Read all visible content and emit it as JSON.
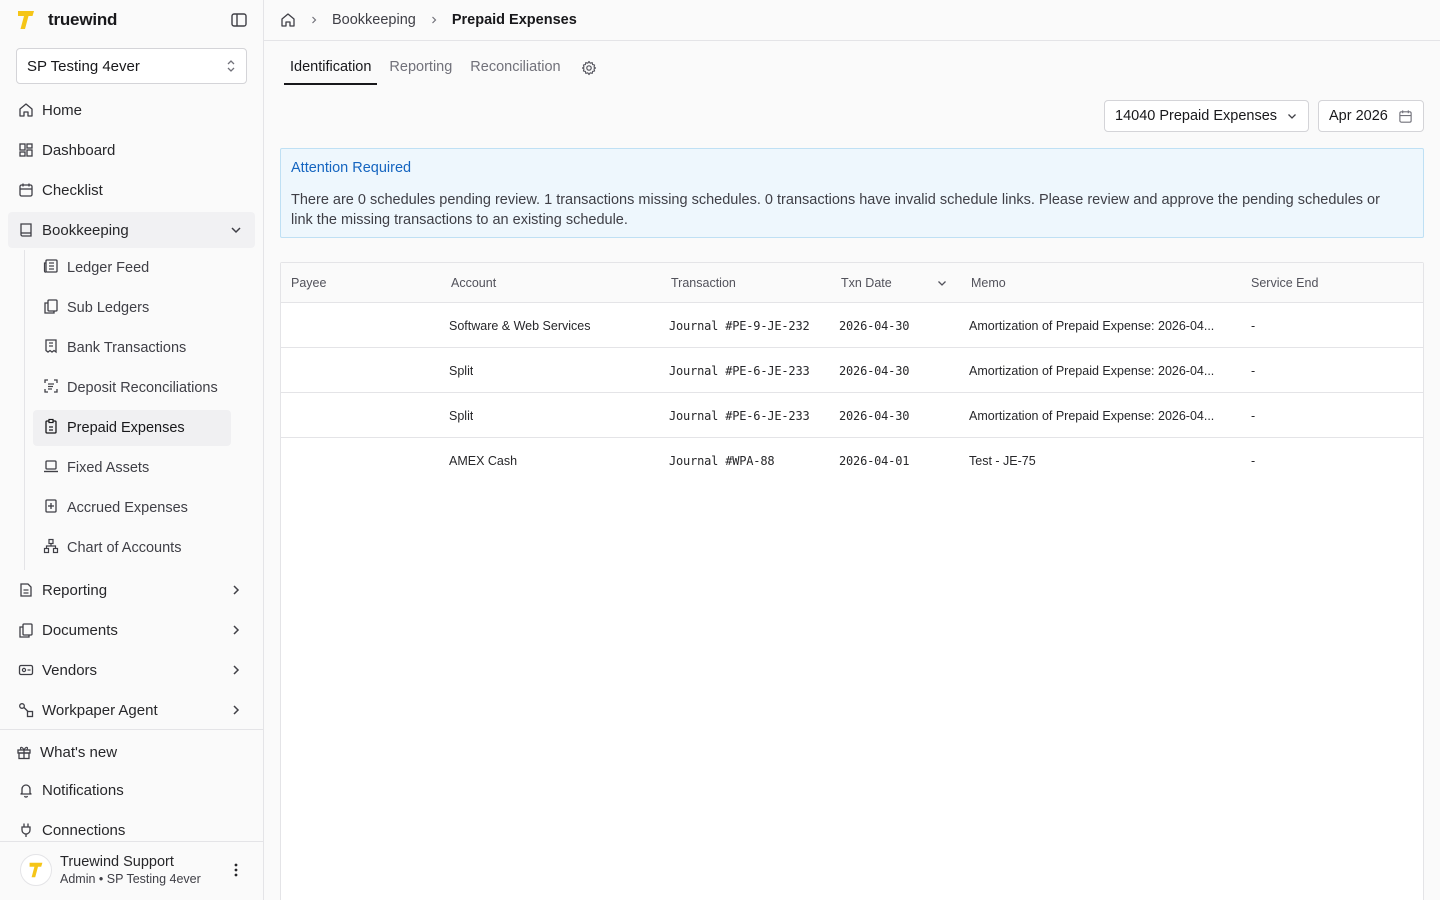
{
  "brand": {
    "name": "truewind"
  },
  "org": {
    "name": "SP Testing 4ever"
  },
  "nav": {
    "home": "Home",
    "dashboard": "Dashboard",
    "checklist": "Checklist",
    "bookkeeping": "Bookkeeping",
    "bookkeeping_items": [
      "Ledger Feed",
      "Sub Ledgers",
      "Bank Transactions",
      "Deposit Reconciliations",
      "Prepaid Expenses",
      "Fixed Assets",
      "Accrued Expenses",
      "Chart of Accounts"
    ],
    "reporting": "Reporting",
    "documents": "Documents",
    "vendors": "Vendors",
    "workpaper_agent": "Workpaper Agent",
    "whats_new": "What's new",
    "notifications": "Notifications",
    "connections": "Connections"
  },
  "user": {
    "name": "Truewind Support",
    "role": "Admin • SP Testing 4ever"
  },
  "breadcrumb": {
    "parent": "Bookkeeping",
    "current": "Prepaid Expenses"
  },
  "tabs": [
    "Identification",
    "Reporting",
    "Reconciliation"
  ],
  "filters": {
    "account": "14040 Prepaid Expenses",
    "period": "Apr 2026"
  },
  "alert": {
    "title": "Attention Required",
    "line1": "There are 0 schedules pending review. 1 transactions missing schedules. 0 transactions have invalid schedule links. Please review and approve the pending schedules or",
    "line2": "link the missing transactions to an existing schedule."
  },
  "table": {
    "columns": [
      "Payee",
      "Account",
      "Transaction",
      "Txn Date",
      "Memo",
      "Service End"
    ],
    "rows": [
      {
        "payee": "",
        "account": "Software & Web Services",
        "transaction": "Journal #PE-9-JE-232",
        "date": "2026-04-30",
        "memo": "Amortization of Prepaid Expense: 2026-04...",
        "service_end": "-"
      },
      {
        "payee": "",
        "account": "Split",
        "transaction": "Journal #PE-6-JE-233",
        "date": "2026-04-30",
        "memo": "Amortization of Prepaid Expense: 2026-04...",
        "service_end": "-"
      },
      {
        "payee": "",
        "account": "Split",
        "transaction": "Journal #PE-6-JE-233",
        "date": "2026-04-30",
        "memo": "Amortization of Prepaid Expense: 2026-04...",
        "service_end": "-"
      },
      {
        "payee": "",
        "account": "AMEX Cash",
        "transaction": "Journal #WPA-88",
        "date": "2026-04-01",
        "memo": "Test - JE-75",
        "service_end": "-"
      }
    ]
  },
  "colors": {
    "accent": "#f5c518",
    "alert_title": "#1565c0",
    "alert_bg": "#eef7fd"
  }
}
